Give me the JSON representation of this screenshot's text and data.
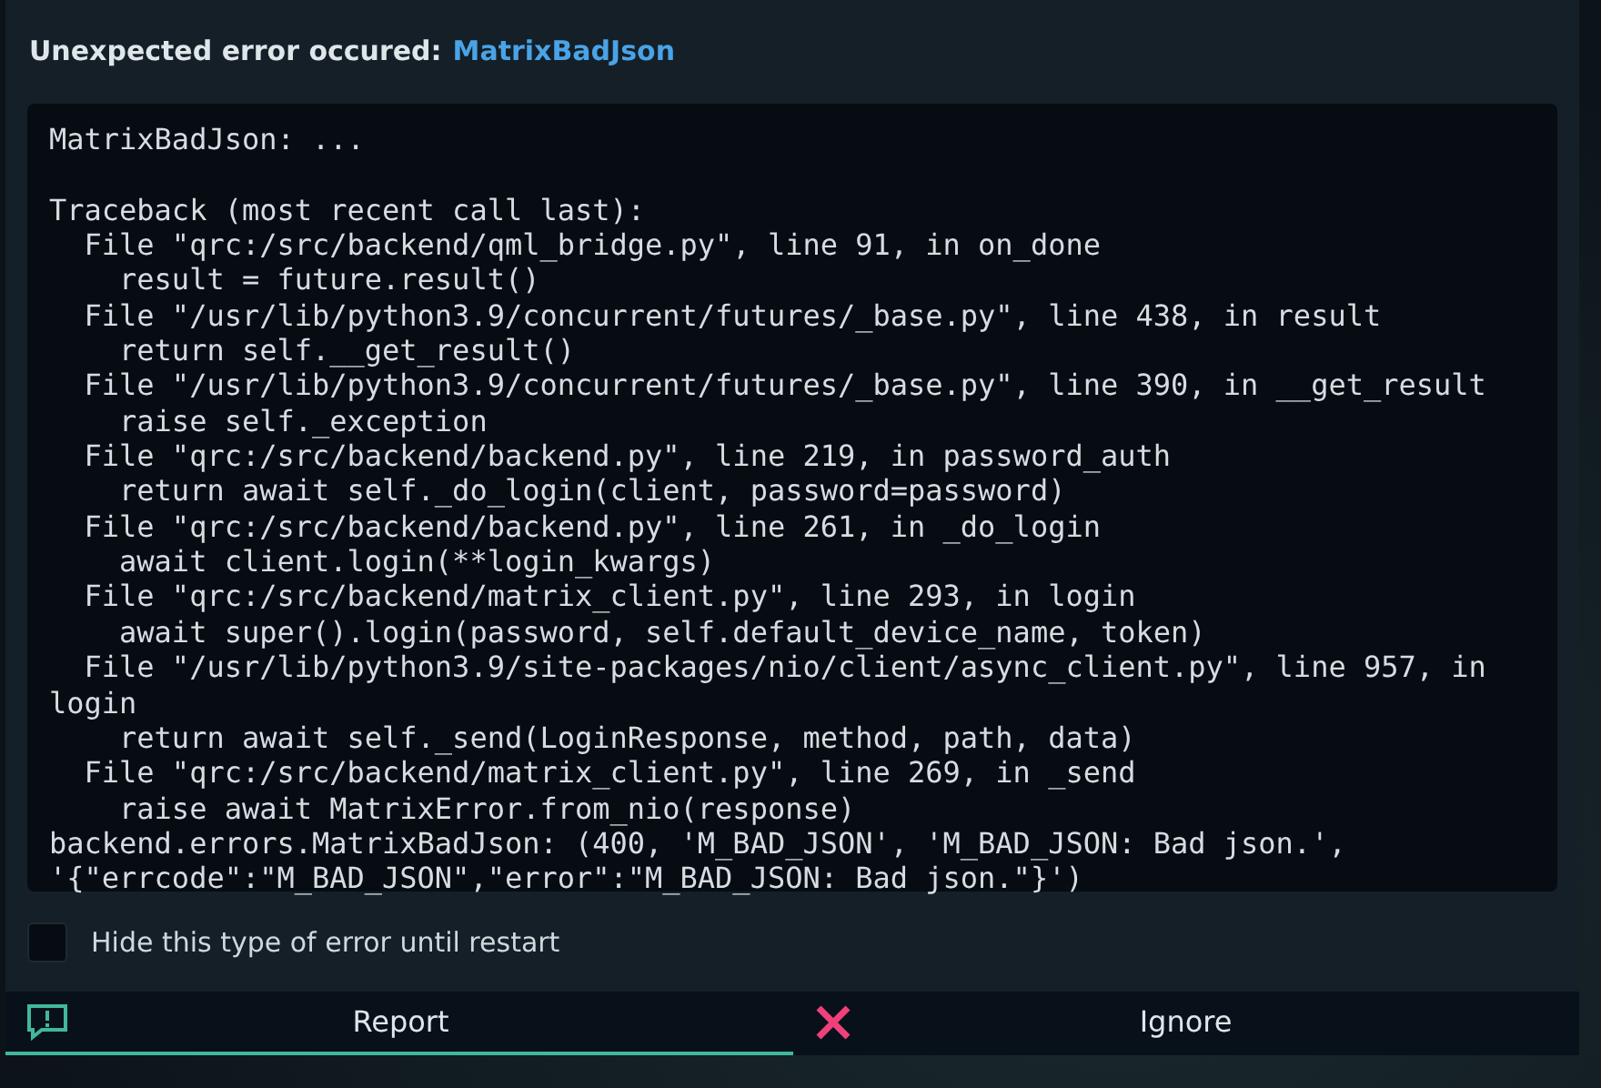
{
  "dialog": {
    "title": "Unexpected error occured:",
    "error_type": "MatrixBadJson",
    "summary": "MatrixBadJson: ...",
    "traceback": [
      "Traceback (most recent call last):",
      "  File \"qrc:/src/backend/qml_bridge.py\", line 91, in on_done",
      "    result = future.result()",
      "  File \"/usr/lib/python3.9/concurrent/futures/_base.py\", line 438, in result",
      "    return self.__get_result()",
      "  File \"/usr/lib/python3.9/concurrent/futures/_base.py\", line 390, in __get_result",
      "    raise self._exception",
      "  File \"qrc:/src/backend/backend.py\", line 219, in password_auth",
      "    return await self._do_login(client, password=password)",
      "  File \"qrc:/src/backend/backend.py\", line 261, in _do_login",
      "    await client.login(**login_kwargs)",
      "  File \"qrc:/src/backend/matrix_client.py\", line 293, in login",
      "    await super().login(password, self.default_device_name, token)",
      "  File \"/usr/lib/python3.9/site-packages/nio/client/async_client.py\", line 957, in login",
      "    return await self._send(LoginResponse, method, path, data)",
      "  File \"qrc:/src/backend/matrix_client.py\", line 269, in _send",
      "    raise await MatrixError.from_nio(response)",
      "backend.errors.MatrixBadJson: (400, 'M_BAD_JSON', 'M_BAD_JSON: Bad json.', '{\"errcode\":\"M_BAD_JSON\",\"error\":\"M_BAD_JSON: Bad json.\"}')"
    ],
    "hide_checkbox": {
      "label": "Hide this type of error until restart",
      "checked": false
    },
    "buttons": [
      {
        "kind": "report",
        "label": "Report",
        "selected": true
      },
      {
        "kind": "ignore",
        "label": "Ignore",
        "selected": false
      }
    ]
  }
}
